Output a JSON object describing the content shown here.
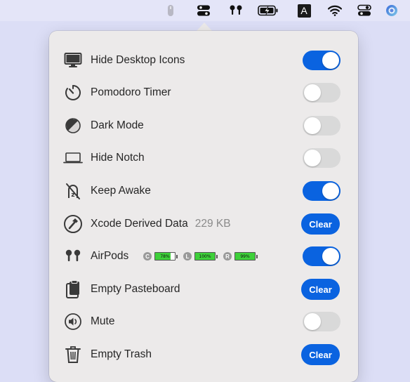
{
  "menubar": {
    "icons": [
      "mouse-icon",
      "control-center-toggle-icon",
      "airpods-icon",
      "battery-charging-icon",
      "input-source-icon",
      "wifi-icon",
      "control-center-icon",
      "siri-icon"
    ],
    "input_source_letter": "A"
  },
  "panel": {
    "rows": [
      {
        "label": "Hide Desktop Icons",
        "control": "toggle",
        "on": true,
        "icon": "display-icon"
      },
      {
        "label": "Pomodoro Timer",
        "control": "toggle",
        "on": false,
        "icon": "timer-icon"
      },
      {
        "label": "Dark Mode",
        "control": "toggle",
        "on": false,
        "icon": "dark-mode-icon"
      },
      {
        "label": "Hide Notch",
        "control": "toggle",
        "on": false,
        "icon": "laptop-icon"
      },
      {
        "label": "Keep Awake",
        "control": "toggle",
        "on": true,
        "icon": "sleep-slash-icon"
      },
      {
        "label": "Xcode Derived Data",
        "sub": "229 KB",
        "control": "button",
        "button_label": "Clear",
        "icon": "hammer-icon"
      },
      {
        "label": "AirPods",
        "control": "toggle",
        "on": true,
        "icon": "airpods-icon"
      },
      {
        "label": "Empty Pasteboard",
        "control": "button",
        "button_label": "Clear",
        "icon": "clipboard-icon"
      },
      {
        "label": "Mute",
        "control": "toggle",
        "on": false,
        "icon": "speaker-icon"
      },
      {
        "label": "Empty Trash",
        "control": "button",
        "button_label": "Clear",
        "icon": "trash-icon"
      }
    ],
    "airpods_batteries": [
      {
        "letter": "C",
        "percent_label": "78%",
        "level": 0.78
      },
      {
        "letter": "L",
        "percent_label": "100%",
        "level": 1.0
      },
      {
        "letter": "R",
        "percent_label": "99%",
        "level": 0.99
      }
    ]
  },
  "colors": {
    "accent": "#0a63e0",
    "toggle_off": "#d9d9d9",
    "panel_bg": "#eceaea",
    "battery_green": "#3ed03a"
  }
}
